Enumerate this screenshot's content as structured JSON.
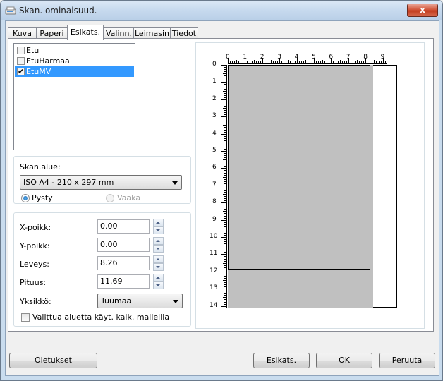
{
  "window": {
    "title": "Skan. ominaisuud.",
    "close_label": "x"
  },
  "tabs": [
    {
      "label": "Kuva"
    },
    {
      "label": "Paperi"
    },
    {
      "label": "Esikats.",
      "active": true
    },
    {
      "label": "Valinn."
    },
    {
      "label": "Leimasin"
    },
    {
      "label": "Tiedot"
    }
  ],
  "image_list": [
    {
      "label": "Etu",
      "checked": false
    },
    {
      "label": "EtuHarmaa",
      "checked": false
    },
    {
      "label": "EtuMV",
      "checked": true,
      "selected": true
    }
  ],
  "scan_area": {
    "label": "Skan.alue:",
    "selected": "ISO A4 - 210 x 297 mm",
    "orientation_portrait": "Pysty",
    "orientation_landscape": "Vaaka"
  },
  "fields": {
    "x_offset_label": "X-poikk:",
    "x_offset_value": "0.00",
    "y_offset_label": "Y-poikk:",
    "y_offset_value": "0.00",
    "width_label": "Leveys:",
    "width_value": "8.26",
    "length_label": "Pituus:",
    "length_value": "11.69",
    "unit_label": "Yksikkö:",
    "unit_value": "Tuumaa",
    "apply_all_label": "Valittua aluetta käyt. kaik. malleilla"
  },
  "ruler": {
    "x_labels": [
      "0",
      "1",
      "2",
      "3",
      "4",
      "5",
      "6",
      "7",
      "8",
      "9"
    ],
    "y_labels": [
      "0",
      "1",
      "2",
      "3",
      "4",
      "5",
      "6",
      "7",
      "8",
      "9",
      "10",
      "11",
      "12",
      "13",
      "14"
    ]
  },
  "buttons": {
    "defaults": "Oletukset",
    "preview": "Esikats.",
    "ok": "OK",
    "cancel": "Peruuta"
  }
}
